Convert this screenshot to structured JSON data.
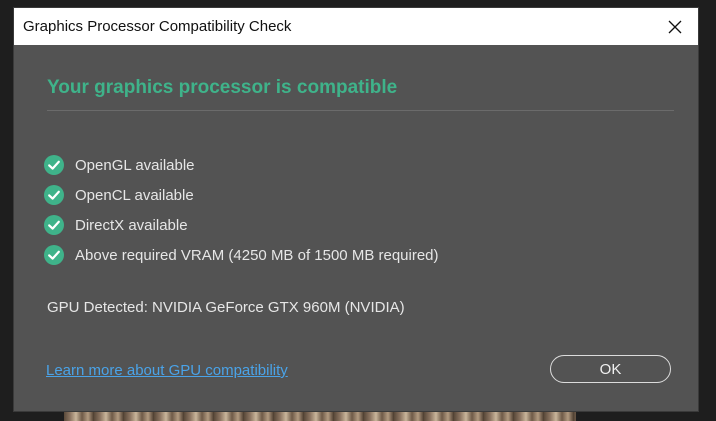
{
  "window": {
    "title": "Graphics Processor Compatibility Check",
    "close_icon": "close-icon"
  },
  "main": {
    "heading": "Your graphics processor is compatible",
    "accent_color": "#3fb38a",
    "checks": [
      {
        "label": "OpenGL available",
        "status": "pass",
        "icon": "check-circle-icon"
      },
      {
        "label": "OpenCL available",
        "status": "pass",
        "icon": "check-circle-icon"
      },
      {
        "label": "DirectX available",
        "status": "pass",
        "icon": "check-circle-icon"
      },
      {
        "label": "Above required VRAM (4250 MB of 1500 MB required)",
        "status": "pass",
        "icon": "check-circle-icon"
      }
    ],
    "gpu_detected": "GPU Detected: NVIDIA GeForce GTX 960M (NVIDIA)"
  },
  "footer": {
    "learn_more_link": "Learn more about GPU compatibility",
    "ok_label": "OK"
  },
  "colors": {
    "dialog_background": "#535353",
    "link": "#4aa3e8",
    "text": "#e6e6e6"
  }
}
